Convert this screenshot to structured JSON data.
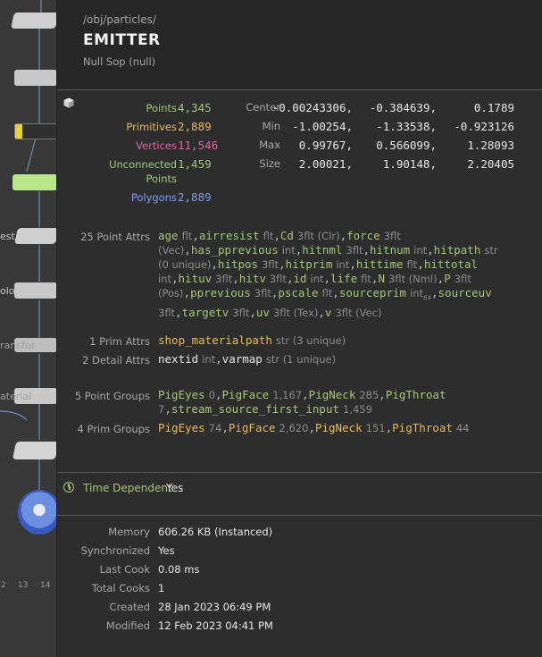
{
  "network": {
    "node_labels": [
      "est",
      "olo",
      "ransfor",
      "aterial"
    ],
    "ruler_ticks": [
      "2",
      "13",
      "14"
    ]
  },
  "header": {
    "path": "/obj/particles/",
    "title": "EMITTER",
    "node_type": "Null Sop (null)"
  },
  "counts": [
    {
      "label": "Points",
      "value": "4,345",
      "color": "#a8c57a"
    },
    {
      "label": "Primitives",
      "value": "2,889",
      "color": "#e8b95a"
    },
    {
      "label": "Vertices",
      "value": "11,546",
      "color": "#d66aa6"
    },
    {
      "label": "Unconnected Points",
      "value": "1,459",
      "color": "#a8c57a"
    },
    {
      "label": "Polygons",
      "value": "2,889",
      "color": "#7d9ef0"
    }
  ],
  "bounds": {
    "rows": [
      {
        "label": "Center",
        "v": [
          "-0.00243306,",
          "-0.384639,",
          "0.1789"
        ]
      },
      {
        "label": "Min",
        "v": [
          "-1.00254,",
          "-1.33538,",
          "-0.923126"
        ]
      },
      {
        "label": "Max",
        "v": [
          "0.99767,",
          "0.566099,",
          "1.28093"
        ]
      },
      {
        "label": "Size",
        "v": [
          "2.00021,",
          "1.90148,",
          "2.20405"
        ]
      }
    ]
  },
  "point_attrs": {
    "label": "25 Point Attrs",
    "items": [
      {
        "name": "age",
        "type": "flt"
      },
      {
        "name": "airresist",
        "type": "flt"
      },
      {
        "name": "Cd",
        "type": "3flt (Clr)"
      },
      {
        "name": "force",
        "type": "3flt (Vec)"
      },
      {
        "name": "has_pprevious",
        "type": "int"
      },
      {
        "name": "hitnml",
        "type": "3flt"
      },
      {
        "name": "hitnum",
        "type": "int"
      },
      {
        "name": "hitpath",
        "type": "str (0 unique)"
      },
      {
        "name": "hitpos",
        "type": "3flt"
      },
      {
        "name": "hitprim",
        "type": "int"
      },
      {
        "name": "hittime",
        "type": "flt"
      },
      {
        "name": "hittotal",
        "type": "int"
      },
      {
        "name": "hituv",
        "type": "3flt"
      },
      {
        "name": "hitv",
        "type": "3flt"
      },
      {
        "name": "id",
        "type": "int"
      },
      {
        "name": "life",
        "type": "flt"
      },
      {
        "name": "N",
        "type": "3flt (Nml)"
      },
      {
        "name": "P",
        "type": "3flt (Pos)"
      },
      {
        "name": "pprevious",
        "type": "3flt"
      },
      {
        "name": "pscale",
        "type": "flt"
      },
      {
        "name": "sourceprim",
        "type": "int",
        "sub": "64"
      },
      {
        "name": "sourceuv",
        "type": "3flt"
      },
      {
        "name": "targetv",
        "type": "3flt"
      },
      {
        "name": "uv",
        "type": "3flt (Tex)"
      },
      {
        "name": "v",
        "type": "3flt (Vec)"
      }
    ]
  },
  "prim_attrs": {
    "label": "1 Prim Attrs",
    "items": [
      {
        "name": "shop_materialpath",
        "type": "str (3 unique)"
      }
    ]
  },
  "detail_attrs": {
    "label": "2 Detail Attrs",
    "items": [
      {
        "name": "nextid",
        "type": "int"
      },
      {
        "name": "varmap",
        "type": "str (1 unique)"
      }
    ]
  },
  "point_groups": {
    "label": "5 Point Groups",
    "items": [
      {
        "name": "PigEyes",
        "count": "0"
      },
      {
        "name": "PigFace",
        "count": "1,167"
      },
      {
        "name": "PigNeck",
        "count": "285"
      },
      {
        "name": "PigThroat",
        "count": "7"
      },
      {
        "name": "stream_source_first_input",
        "count": "1,459"
      }
    ]
  },
  "prim_groups": {
    "label": "4 Prim Groups",
    "items": [
      {
        "name": "PigEyes",
        "count": "74"
      },
      {
        "name": "PigFace",
        "count": "2,620"
      },
      {
        "name": "PigNeck",
        "count": "151"
      },
      {
        "name": "PigThroat",
        "count": "44"
      }
    ]
  },
  "time_dependent": {
    "label": "Time Dependent",
    "value": "Yes"
  },
  "info": [
    {
      "label": "Memory",
      "value": "606.26 KB (Instanced)"
    },
    {
      "label": "Synchronized",
      "value": "Yes"
    },
    {
      "label": "Last Cook",
      "value": "0.08 ms"
    },
    {
      "label": "Total Cooks",
      "value": "1"
    },
    {
      "label": "Created",
      "value": "28 Jan 2023 06:49 PM"
    },
    {
      "label": "Modified",
      "value": "12 Feb 2023 04:41 PM"
    }
  ],
  "colors": {
    "green": "#a8c57a",
    "orange": "#e8b95a",
    "pink": "#d66aa6",
    "blue": "#7d9ef0",
    "background": "#2d2d2d"
  }
}
